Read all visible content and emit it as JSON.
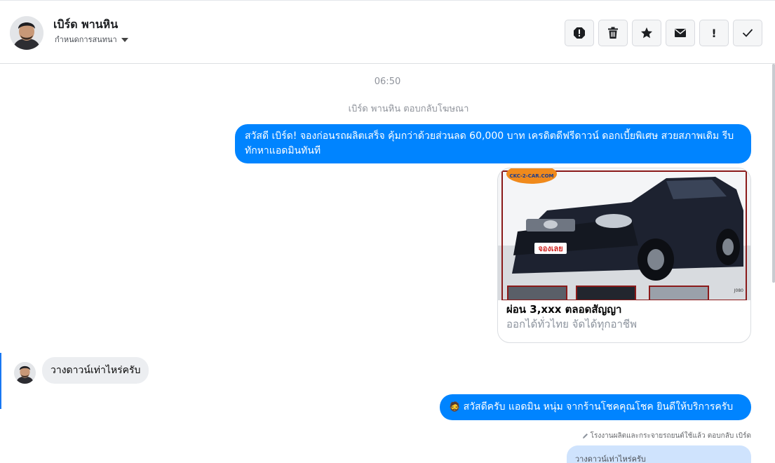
{
  "conversation": {
    "name": "เบิร์ด พานหิน",
    "assign_label": "กำหนดการสนทนา"
  },
  "toolbar": {
    "buttons": [
      {
        "icon": "spam-icon"
      },
      {
        "icon": "trash-icon"
      },
      {
        "icon": "star-icon"
      },
      {
        "icon": "envelope-icon"
      },
      {
        "icon": "exclamation-icon",
        "label": "!"
      },
      {
        "icon": "checkmark-icon"
      }
    ]
  },
  "thread": {
    "timestamp": "06:50",
    "system_note": "เบิร์ด พานหิน ตอบกลับโฆษณา",
    "message1": "สวัสดี เบิร์ด! จองก่อนรถผลิตเสร็จ คุ้มกว่าด้วยส่วนลด 60,000 บาท เครดิตดีฟรีดาวน์ ดอกเบี้ยพิเศษ สวยสภาพเดิม รีบทักหาแอดมินทันที",
    "card": {
      "title": "ผ่อน 3,xxx ตลอดสัญญา",
      "subtitle": "ออกได้ทั่วไทย จัดได้ทุกอาชีพ",
      "image_brand": "CKC-2-CAR.COM",
      "image_badge": "จองเลย",
      "image_corner": "J080"
    },
    "incoming1": "วางดาวน์เท่าไหร่ครับ",
    "message2": "สวัสดีครับ แอดมิน หนุ่ม จากร้านโชคคุณโชค ยินดีให้บริการครับ",
    "message2_emoji": "🧔",
    "reply_note": "โรงงานผลิตและกระจายรถยนต์ใช้แล้ว ตอบกลับ เบิร์ด",
    "reply_quote": "วางดาวน์เท่าไหร่ครับ"
  },
  "colors": {
    "accent": "#0084ff",
    "incoming_bubble": "#eceef1",
    "reply_quote_bg": "#cfe3fd",
    "active_indicator": "#1877f2"
  }
}
